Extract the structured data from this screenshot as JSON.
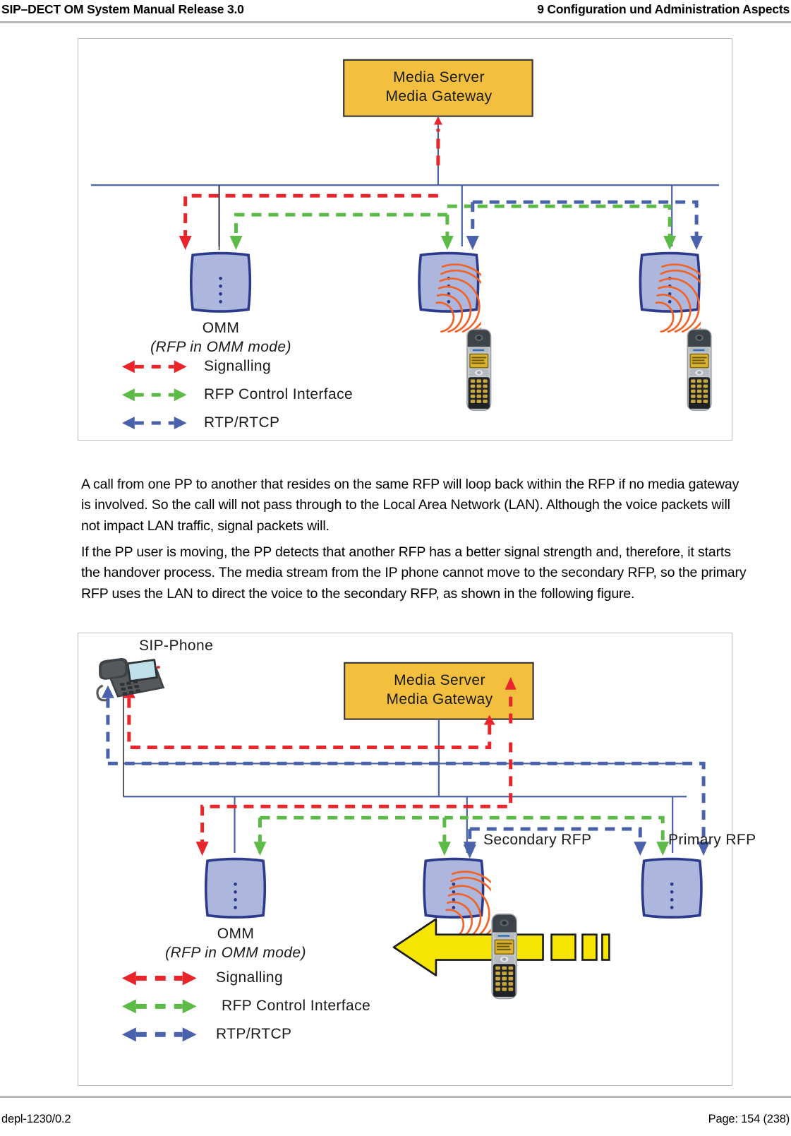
{
  "header": {
    "left": "SIP–DECT OM System Manual Release 3.0",
    "right": "9 Configuration und Administration Aspects"
  },
  "footer": {
    "doc_id": "depl-1230/0.2",
    "page": "Page: 154 (238)"
  },
  "body": {
    "paragraph_1": "A call from one PP to another that resides on the same RFP will loop back within the RFP if no media gateway is involved. So the call will not pass through to the Local Area Network (LAN). Although the voice packets will not impact LAN traffic, signal packets will.",
    "paragraph_2": "If the PP user is moving, the PP detects that another RFP has a better signal strength and, therefore, it starts the handover process. The media stream from the IP phone cannot move to the secondary RFP, so the primary RFP uses the LAN to direct the voice to the secondary RFP, as shown in the following figure."
  },
  "colors": {
    "signalling": "#e8252a",
    "rfp_control": "#5cba47",
    "rtp_rtcp": "#4a62ab",
    "media_box_fill": "#f2bf3f",
    "media_box_stroke": "#3a3a3a",
    "rfp_box_fill": "#adb7dd",
    "rfp_box_stroke": "#2b3a8c",
    "bus_line": "#4a62ab",
    "radio_wave": "#f0642a",
    "move_arrow_fill": "#f5e500",
    "move_arrow_stroke": "#1a1a1a",
    "frame_border": "#bcbcbc"
  },
  "figure_1": {
    "name": "call-within-same-rfp",
    "media_box": {
      "line1": "Media Server",
      "line2": "Media Gateway"
    },
    "omm_label": {
      "line1": "OMM",
      "line2": "(RFP in OMM mode)"
    },
    "legend": [
      {
        "label": "Signalling",
        "color_key": "signalling"
      },
      {
        "label": "RFP Control Interface",
        "color_key": "rfp_control"
      },
      {
        "label": "RTP/RTCP",
        "color_key": "rtp_rtcp"
      }
    ],
    "rfp_count": 3,
    "handset_count": 2
  },
  "figure_2": {
    "name": "handover-between-rfps",
    "sip_phone_label": "SIP-Phone",
    "media_box": {
      "line1": "Media Server",
      "line2": "Media Gateway"
    },
    "secondary_rfp_label": "Secondary RFP",
    "primary_rfp_label": "Primary RFP",
    "omm_label": {
      "line1": "OMM",
      "line2": "(RFP in OMM mode)"
    },
    "legend": [
      {
        "label": "Signalling",
        "color_key": "signalling"
      },
      {
        "label": "RFP Control Interface",
        "color_key": "rfp_control"
      },
      {
        "label": "RTP/RTCP",
        "color_key": "rtp_rtcp"
      }
    ],
    "rfp_count": 3,
    "handset_count": 1,
    "movement_indicator": "yellow-left-arrow"
  }
}
